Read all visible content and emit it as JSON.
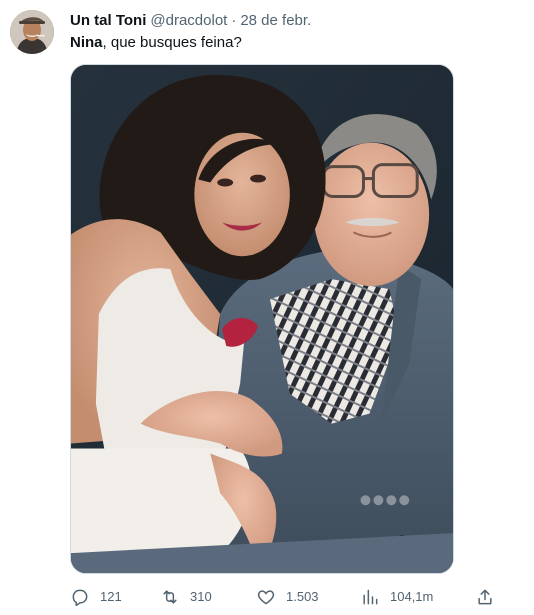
{
  "tweet": {
    "author": {
      "display_name": "Un tal Toni",
      "handle": "@dracdolot",
      "avatar_icon": "user-avatar"
    },
    "separator": "·",
    "date": "28 de febr.",
    "text": {
      "mention": "Nina",
      "body": ", que busques feina?"
    },
    "media": {
      "kind": "photo"
    },
    "actions": {
      "reply": {
        "icon": "reply-icon",
        "count": "121"
      },
      "retweet": {
        "icon": "retweet-icon",
        "count": "310"
      },
      "like": {
        "icon": "heart-icon",
        "count": "1.503"
      },
      "views": {
        "icon": "views-chart-icon",
        "count": "104,1m"
      },
      "share": {
        "icon": "share-icon"
      }
    }
  },
  "colors": {
    "text_primary": "#0f1419",
    "text_secondary": "#536471",
    "border": "#cfd9de"
  }
}
